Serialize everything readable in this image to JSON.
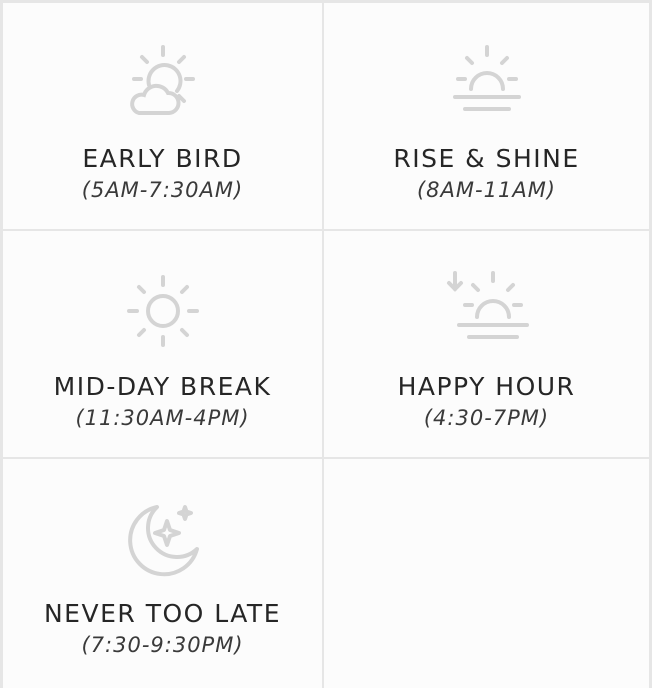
{
  "slots": [
    {
      "title": "EARLY BIRD",
      "time": "(5AM-7:30AM)",
      "icon": "sun-behind-cloud-icon"
    },
    {
      "title": "RISE & SHINE",
      "time": "(8AM-11AM)",
      "icon": "sunrise-icon"
    },
    {
      "title": "MID-DAY BREAK",
      "time": "(11:30AM-4PM)",
      "icon": "sun-icon"
    },
    {
      "title": "HAPPY HOUR",
      "time": "(4:30-7PM)",
      "icon": "sunset-icon"
    },
    {
      "title": "NEVER TOO LATE",
      "time": "(7:30-9:30PM)",
      "icon": "moon-stars-icon"
    }
  ],
  "colors": {
    "icon": "#d4d4d4",
    "border": "#e6e6e6",
    "title_text": "#262626",
    "time_text": "#3a3a3a"
  }
}
